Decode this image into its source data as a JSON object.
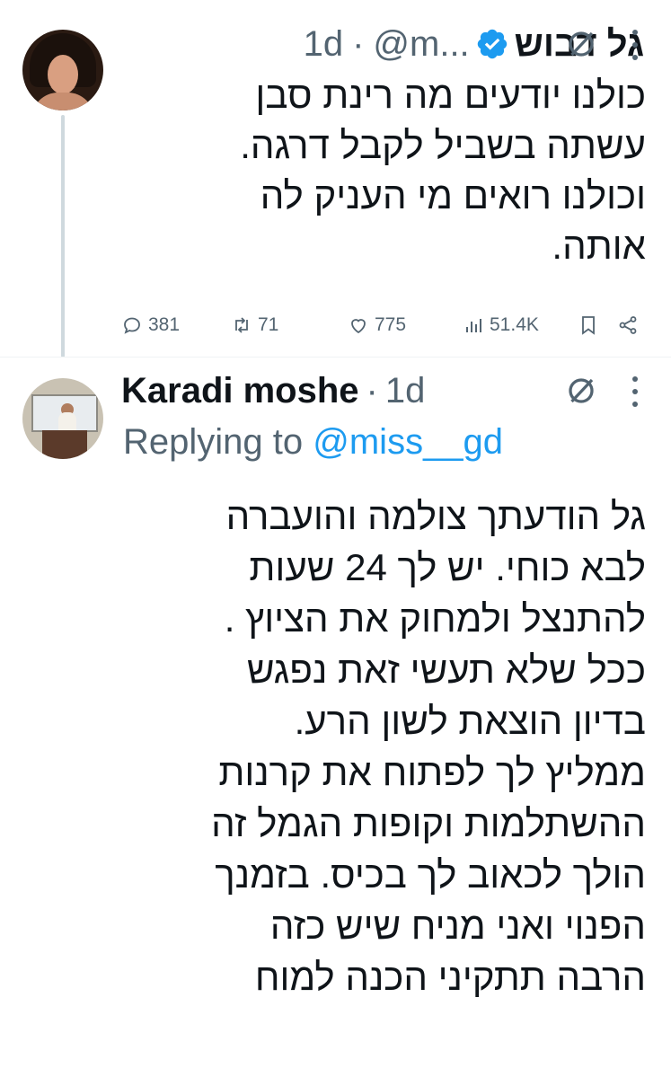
{
  "tweet1": {
    "name": "גל דבוש",
    "handle": "@m...",
    "dot": "·",
    "time": "1d",
    "text_lines": [
      "כולנו יודעים מה רינת סבן",
      "עשתה בשביל לקבל דרגה.",
      "וכולנו רואים מי העניק לה",
      "אותה."
    ],
    "stats": {
      "replies": "381",
      "retweets": "71",
      "likes": "775",
      "views": "51.4K"
    }
  },
  "tweet2": {
    "name": "Karadi moshe",
    "dot": "·",
    "time": "1d",
    "replying_prefix": "Replying to",
    "replying_mention": "@miss__gd",
    "text_lines": [
      "גל הודעתך צולמה והועברה",
      "לבא כוחי. יש לך 24 שעות",
      "להתנצל ולמחוק את הציוץ .",
      "ככל שלא תעשי זאת נפגש",
      "בדיון הוצאת לשון הרע.",
      "ממליץ לך לפתוח את קרנות",
      "ההשתלמות וקופות הגמל זה",
      "הולך לכאוב לך בכיס. בזמנך",
      "הפנוי ואני מניח שיש כזה",
      "הרבה תתקיני הכנה למוח"
    ]
  },
  "colors": {
    "text": "#0f1419",
    "secondary": "#536471",
    "accent": "#1d9bf0",
    "thread_line": "#cfd9de"
  },
  "icons": [
    "verified-badge-icon",
    "grok-icon",
    "more-icon",
    "reply-icon",
    "retweet-icon",
    "like-icon",
    "views-icon",
    "bookmark-icon",
    "share-icon"
  ]
}
